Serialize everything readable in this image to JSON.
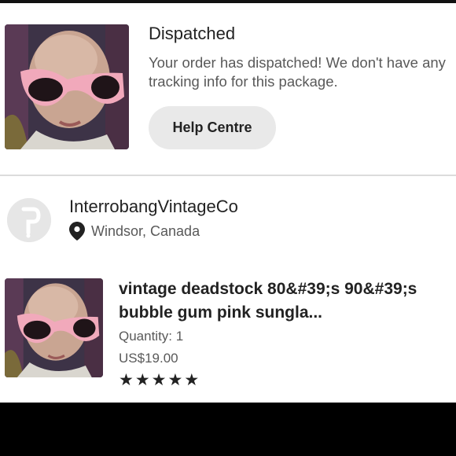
{
  "shipping": {
    "title": "Dispatched",
    "message": "Your order has dispatched! We don't have any tracking info for this package.",
    "help_button": "Help Centre",
    "thumb_icon": "mannequin-pink-sunglasses-photo"
  },
  "shop": {
    "name": "InterrobangVintageCo",
    "location": "Windsor, Canada",
    "avatar_icon": "shop-avatar-icon",
    "location_icon": "map-pin-icon"
  },
  "item": {
    "title": "vintage deadstock 80&#39;s 90&#39;s bubble gum pink sungla...",
    "quantity": "Quantity: 1",
    "price": "US$19.00",
    "rating": 5,
    "stars": [
      "★",
      "★",
      "★",
      "★",
      "★"
    ]
  },
  "colors": {
    "accent_button_bg": "#e9e9e9",
    "text_primary": "#222222",
    "text_secondary": "#595959",
    "divider": "#dcdcdc"
  }
}
